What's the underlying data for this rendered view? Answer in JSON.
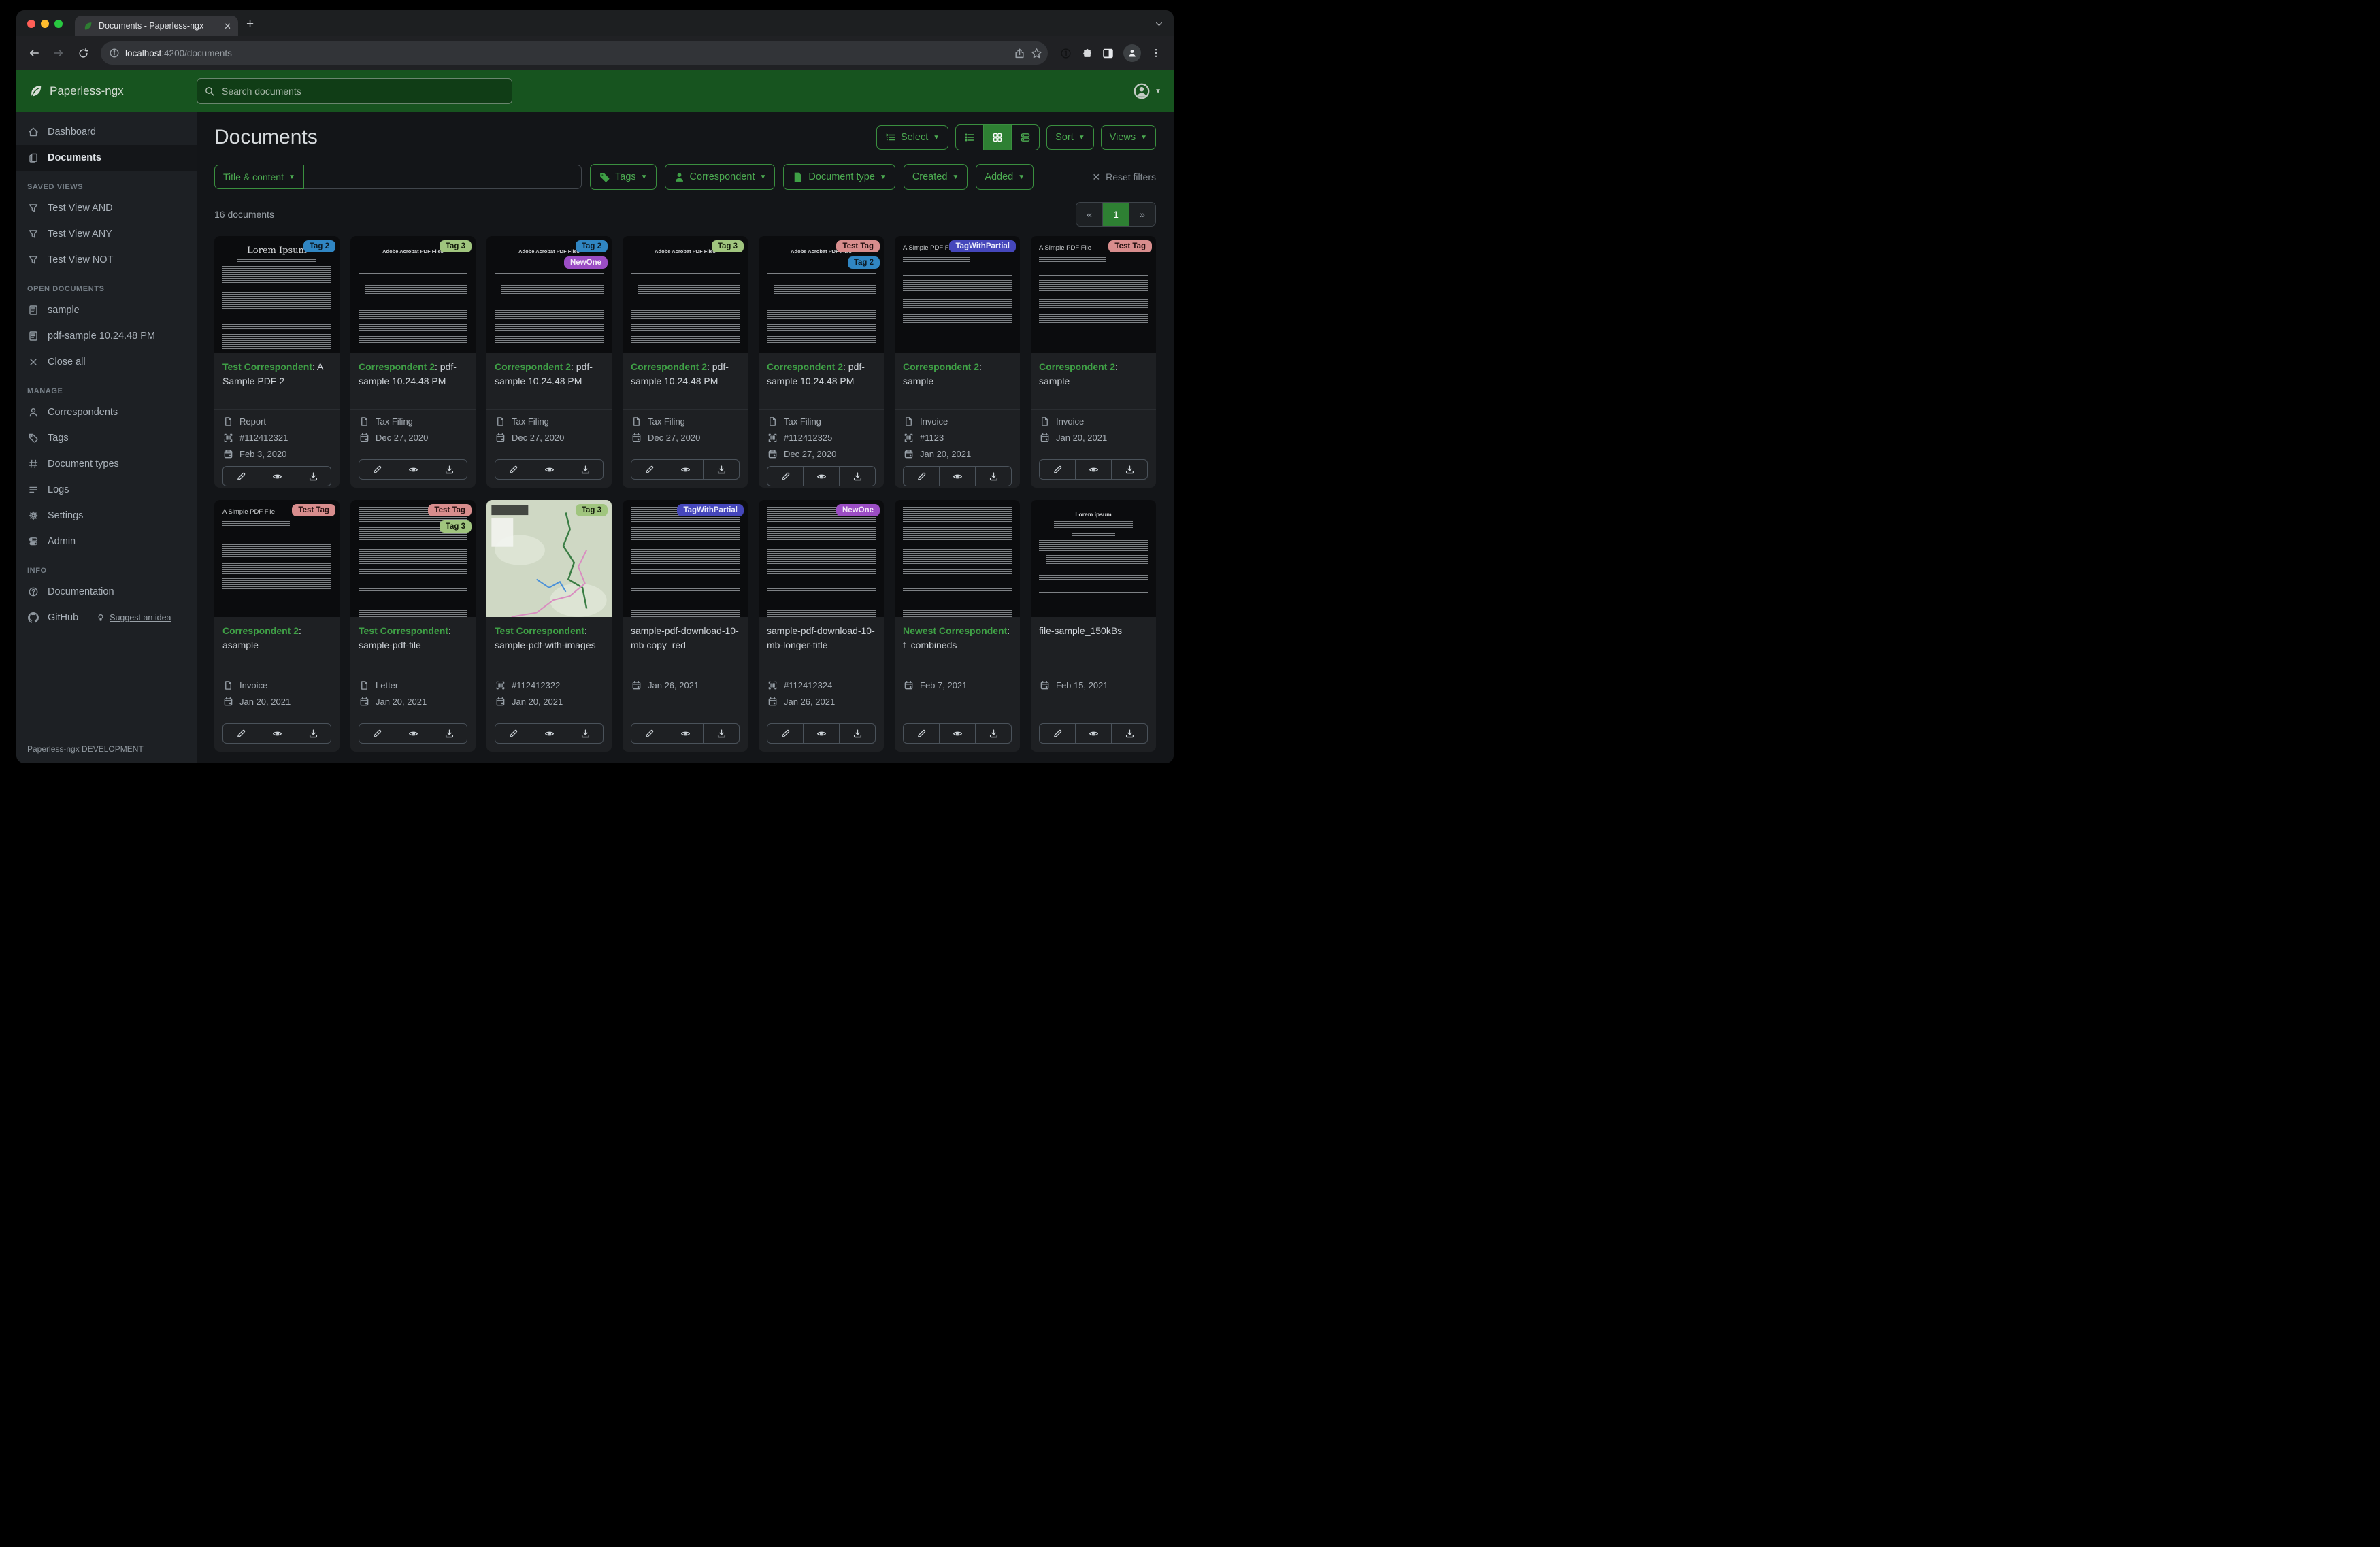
{
  "browser": {
    "tab_title": "Documents - Paperless-ngx",
    "url_host": "localhost",
    "url_path": ":4200/documents"
  },
  "navbar": {
    "brand": "Paperless-ngx",
    "search_placeholder": "Search documents"
  },
  "sidebar": {
    "sections": [
      {
        "header": null,
        "items": [
          {
            "icon": "home",
            "label": "Dashboard",
            "active": false
          },
          {
            "icon": "copy",
            "label": "Documents",
            "active": true
          }
        ]
      },
      {
        "header": "SAVED VIEWS",
        "items": [
          {
            "icon": "funnel",
            "label": "Test View AND"
          },
          {
            "icon": "funnel",
            "label": "Test View ANY"
          },
          {
            "icon": "funnel",
            "label": "Test View NOT"
          }
        ]
      },
      {
        "header": "OPEN DOCUMENTS",
        "items": [
          {
            "icon": "doc",
            "label": "sample"
          },
          {
            "icon": "doc",
            "label": "pdf-sample 10.24.48 PM"
          },
          {
            "icon": "x",
            "label": "Close all"
          }
        ]
      },
      {
        "header": "MANAGE",
        "items": [
          {
            "icon": "person",
            "label": "Correspondents"
          },
          {
            "icon": "tag",
            "label": "Tags"
          },
          {
            "icon": "hash",
            "label": "Document types"
          },
          {
            "icon": "logs",
            "label": "Logs"
          },
          {
            "icon": "gear",
            "label": "Settings"
          },
          {
            "icon": "admin",
            "label": "Admin"
          }
        ]
      },
      {
        "header": "INFO",
        "items": [
          {
            "icon": "question",
            "label": "Documentation"
          },
          {
            "icon": "github",
            "label": "GitHub",
            "extra": {
              "icon": "bulb",
              "label": "Suggest an idea"
            }
          }
        ]
      }
    ],
    "footer": "Paperless-ngx DEVELOPMENT"
  },
  "header": {
    "title": "Documents",
    "select_label": "Select",
    "sort_label": "Sort",
    "views_label": "Views"
  },
  "filters": {
    "field_button": "Title & content",
    "buttons": [
      {
        "icon": "tag-fill",
        "label": "Tags"
      },
      {
        "icon": "person-fill",
        "label": "Correspondent"
      },
      {
        "icon": "file-fill",
        "label": "Document type"
      },
      {
        "icon": null,
        "label": "Created"
      },
      {
        "icon": null,
        "label": "Added"
      }
    ],
    "reset_label": "Reset filters"
  },
  "results": {
    "count_text": "16 documents",
    "pager": {
      "prev": "«",
      "page": "1",
      "next": "»"
    }
  },
  "accent": {
    "green": "#3fa046",
    "button_green": "#3a8f3f",
    "active_green": "#2e8033"
  },
  "cards": [
    {
      "preview": {
        "kind": "serif",
        "heading": "Lorem Ipsum"
      },
      "tags": [
        {
          "label": "Tag 2",
          "bg": "#3086c3",
          "fg": "#0d1a24"
        }
      ],
      "correspondent": "Test Correspondent",
      "title": "A Sample PDF 2",
      "meta": {
        "type": "Report",
        "asn": "#112412321",
        "date": "Feb 3, 2020"
      }
    },
    {
      "preview": {
        "kind": "adobe",
        "heading": "Adobe Acrobat PDF Files"
      },
      "tags": [
        {
          "label": "Tag 3",
          "bg": "#a0c57e",
          "fg": "#151d0d"
        }
      ],
      "correspondent": "Correspondent 2",
      "title": "pdf-sample 10.24.48 PM",
      "meta": {
        "type": "Tax Filing",
        "asn": null,
        "date": "Dec 27, 2020"
      }
    },
    {
      "preview": {
        "kind": "adobe",
        "heading": "Adobe Acrobat PDF Files"
      },
      "tags": [
        {
          "label": "Tag 2",
          "bg": "#3086c3",
          "fg": "#0d1a24"
        },
        {
          "label": "NewOne",
          "bg": "#9b4dc4",
          "fg": "#f3e9f7"
        }
      ],
      "correspondent": "Correspondent 2",
      "title": "pdf-sample 10.24.48 PM",
      "meta": {
        "type": "Tax Filing",
        "asn": null,
        "date": "Dec 27, 2020"
      }
    },
    {
      "preview": {
        "kind": "adobe",
        "heading": "Adobe Acrobat PDF Files"
      },
      "tags": [
        {
          "label": "Tag 3",
          "bg": "#a0c57e",
          "fg": "#151d0d"
        }
      ],
      "correspondent": "Correspondent 2",
      "title": "pdf-sample 10.24.48 PM",
      "meta": {
        "type": "Tax Filing",
        "asn": null,
        "date": "Dec 27, 2020"
      }
    },
    {
      "preview": {
        "kind": "adobe",
        "heading": "Adobe Acrobat PDF Files"
      },
      "tags": [
        {
          "label": "Test Tag",
          "bg": "#d88d8d",
          "fg": "#241010"
        },
        {
          "label": "Tag 2",
          "bg": "#3086c3",
          "fg": "#0d1a24"
        }
      ],
      "correspondent": "Correspondent 2",
      "title": "pdf-sample 10.24.48 PM",
      "meta": {
        "type": "Tax Filing",
        "asn": "#112412325",
        "date": "Dec 27, 2020"
      }
    },
    {
      "preview": {
        "kind": "simple",
        "heading": "A Simple PDF File"
      },
      "tags": [
        {
          "label": "TagWithPartial",
          "bg": "#4547bb",
          "fg": "#eceefb"
        }
      ],
      "correspondent": "Correspondent 2",
      "title": "sample",
      "meta": {
        "type": "Invoice",
        "asn": "#1123",
        "date": "Jan 20, 2021"
      }
    },
    {
      "preview": {
        "kind": "simple",
        "heading": "A Simple PDF File"
      },
      "tags": [
        {
          "label": "Test Tag",
          "bg": "#d88d8d",
          "fg": "#241010"
        }
      ],
      "correspondent": "Correspondent 2",
      "title": "sample",
      "meta": {
        "type": "Invoice",
        "asn": null,
        "date": "Jan 20, 2021"
      }
    },
    {
      "preview": {
        "kind": "simple",
        "heading": "A Simple PDF File"
      },
      "tags": [
        {
          "label": "Test Tag",
          "bg": "#d88d8d",
          "fg": "#241010"
        }
      ],
      "correspondent": "Correspondent 2",
      "title": "asample",
      "meta": {
        "type": "Invoice",
        "asn": null,
        "date": "Jan 20, 2021"
      }
    },
    {
      "preview": {
        "kind": "dense",
        "heading": ""
      },
      "tags": [
        {
          "label": "Test Tag",
          "bg": "#d88d8d",
          "fg": "#241010"
        },
        {
          "label": "Tag 3",
          "bg": "#a0c57e",
          "fg": "#151d0d"
        }
      ],
      "correspondent": "Test Correspondent",
      "title": "sample-pdf-file",
      "meta": {
        "type": "Letter",
        "asn": null,
        "date": "Jan 20, 2021"
      }
    },
    {
      "preview": {
        "kind": "map",
        "heading": ""
      },
      "tags": [
        {
          "label": "Tag 3",
          "bg": "#a0c57e",
          "fg": "#151d0d"
        }
      ],
      "correspondent": "Test Correspondent",
      "title": "sample-pdf-with-images",
      "meta": {
        "type": null,
        "asn": "#112412322",
        "date": "Jan 20, 2021"
      }
    },
    {
      "preview": {
        "kind": "dense",
        "heading": ""
      },
      "tags": [
        {
          "label": "TagWithPartial",
          "bg": "#4547bb",
          "fg": "#eceefb"
        }
      ],
      "correspondent": null,
      "title": "sample-pdf-download-10-mb copy_red",
      "meta": {
        "type": null,
        "asn": null,
        "date": "Jan 26, 2021"
      }
    },
    {
      "preview": {
        "kind": "dense",
        "heading": ""
      },
      "tags": [
        {
          "label": "NewOne",
          "bg": "#9b4dc4",
          "fg": "#f3e9f7"
        }
      ],
      "correspondent": null,
      "title": "sample-pdf-download-10-mb-longer-title",
      "meta": {
        "type": null,
        "asn": "#112412324",
        "date": "Jan 26, 2021"
      }
    },
    {
      "preview": {
        "kind": "dense",
        "heading": ""
      },
      "tags": [],
      "correspondent": "Newest Correspondent",
      "title": "f_combineds",
      "meta": {
        "type": null,
        "asn": null,
        "date": "Feb 7, 2021"
      }
    },
    {
      "preview": {
        "kind": "center",
        "heading": "Lorem ipsum"
      },
      "tags": [],
      "correspondent": null,
      "title": "file-sample_150kBs",
      "meta": {
        "type": null,
        "asn": null,
        "date": "Feb 15, 2021"
      }
    }
  ]
}
